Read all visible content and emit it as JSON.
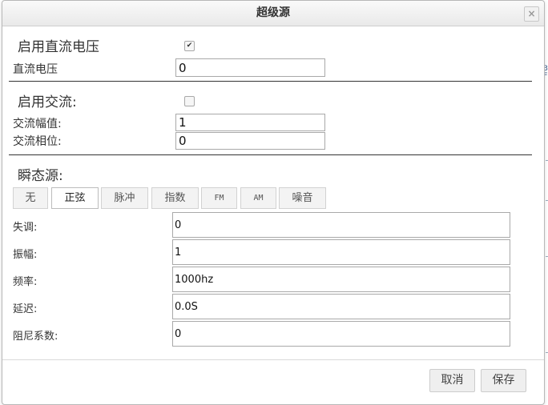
{
  "dialog": {
    "title": "超级源",
    "close_glyph": "×"
  },
  "dc": {
    "enable_label": "启用直流电压",
    "enabled": true,
    "voltage_label": "直流电压",
    "voltage_value": "0"
  },
  "ac": {
    "enable_label": "启用交流:",
    "enabled": false,
    "amplitude_label": "交流幅值:",
    "amplitude_value": "1",
    "phase_label": "交流相位:",
    "phase_value": "0"
  },
  "transient": {
    "label": "瞬态源:",
    "tabs": [
      "无",
      "正弦",
      "脉冲",
      "指数",
      "FM",
      "AM",
      "噪音"
    ],
    "active_tab": "正弦",
    "fields": [
      {
        "label": "失调:",
        "value": "0"
      },
      {
        "label": "振幅:",
        "value": "1"
      },
      {
        "label": "频率:",
        "value": "1000hz"
      },
      {
        "label": "延迟:",
        "value": "0.0S"
      },
      {
        "label": "阻尼系数:",
        "value": "0"
      }
    ]
  },
  "footer": {
    "cancel_label": "取消",
    "save_label": "保存"
  },
  "background": {
    "edge_text": "3\nF"
  }
}
